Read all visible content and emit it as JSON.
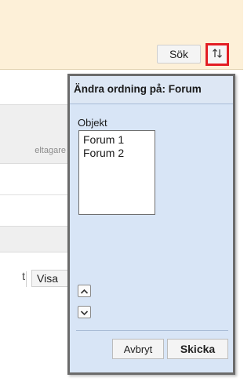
{
  "toolbar": {
    "search_label": "Sök",
    "reorder_icon": "sort-arrows-icon",
    "highlight_color": "#e31e24",
    "background_color": "#fdf0d8"
  },
  "background": {
    "column_label_fragment": "eltagare",
    "text_fragment": "t",
    "visa_label": "Visa"
  },
  "dialog": {
    "title": "Ändra ordning på: Forum",
    "list_label": "Objekt",
    "items": [
      "Forum 1",
      "Forum 2"
    ],
    "move_up_icon": "chevron-up-icon",
    "move_down_icon": "chevron-down-icon",
    "cancel_label": "Avbryt",
    "submit_label": "Skicka",
    "background_color": "#d8e5f6"
  }
}
